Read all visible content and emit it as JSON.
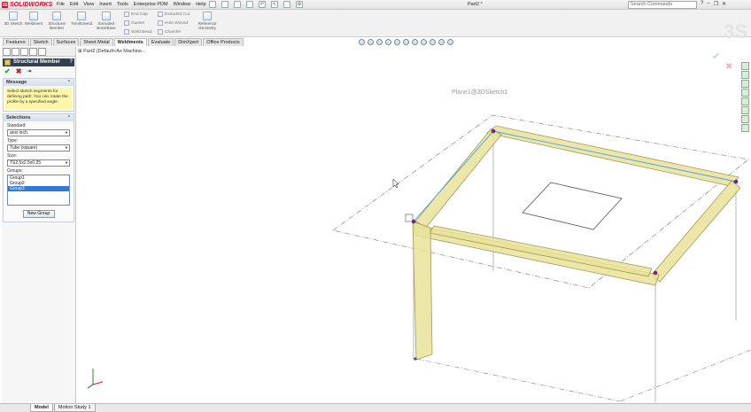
{
  "app": {
    "logo": "SOLIDWORKS",
    "document_title": "Part2 *",
    "menu": [
      "File",
      "Edit",
      "View",
      "Insert",
      "Tools",
      "Enterprise PDM",
      "Window",
      "Help"
    ],
    "search_placeholder": "Search Commands"
  },
  "command_manager": {
    "big_tools": [
      {
        "label": "3D Sketch",
        "icon": "3d-sketch-icon"
      },
      {
        "label": "Weldment",
        "icon": "weldment-icon"
      },
      {
        "label": "Structural Member",
        "icon": "structural-member-icon"
      },
      {
        "label": "Trim/Extend",
        "icon": "trim-extend-icon"
      },
      {
        "label": "Extruded Boss/Base",
        "icon": "extruded-boss-icon"
      },
      {
        "label": "Reference Geometry",
        "icon": "reference-geometry-icon"
      }
    ],
    "small_tools": [
      "End Cap",
      "Gusset",
      "Weld Bead",
      "Extruded Cut",
      "Hole Wizard",
      "Chamfer"
    ],
    "tabs": [
      "Features",
      "Sketch",
      "Surfaces",
      "Sheet Metal",
      "Weldments",
      "Evaluate",
      "DimXpert",
      "Office Products"
    ],
    "active_tab": "Weldments"
  },
  "feature_tree": {
    "root": "Part2  (Default<As Machine..."
  },
  "property_manager": {
    "title": "Structural Member",
    "ok": "✔",
    "cancel": "✖",
    "pin": "⇥",
    "message": {
      "header": "Message",
      "text": "Select sketch segments for defining path. You can rotate the profile by a specified angle."
    },
    "selections": {
      "header": "Selections",
      "standard_label": "Standard:",
      "standard_value": "ansi inch",
      "type_label": "Type:",
      "type_value": "Tube (square)",
      "size_label": "Size:",
      "size_value": "TS2.5x2.5x0.25",
      "groups_label": "Groups:",
      "groups": [
        "Group1",
        "Group2",
        "Group3"
      ],
      "selected_group": "Group3",
      "new_group_button": "New Group"
    }
  },
  "graphics": {
    "plane_label": "Plane1@3DSketch1",
    "frame_color": "#e6df8e",
    "frame_stroke": "#a19a55",
    "point_color": "#7a1c8c",
    "edge_color": "#4aa0e8"
  },
  "bottom_tabs": [
    "Model",
    "Motion Study 1"
  ],
  "active_bottom_tab": "Model"
}
